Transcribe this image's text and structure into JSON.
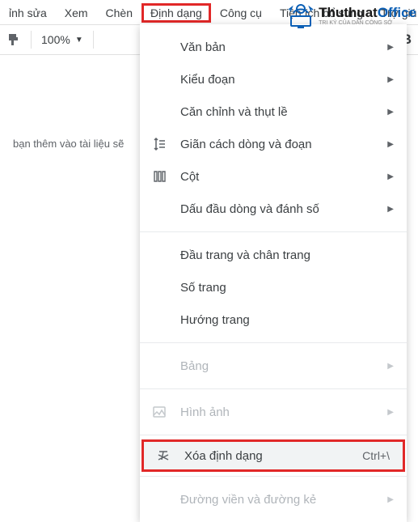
{
  "watermark": {
    "brand_prefix": "Thuthuat",
    "brand_suffix": "Office",
    "tagline": "TRI KỶ CỦA DÂN CÔNG SỞ"
  },
  "menubar": {
    "items": [
      {
        "label": "ỉnh sửa"
      },
      {
        "label": "Xem"
      },
      {
        "label": "Chèn"
      },
      {
        "label": "Định dạng",
        "highlighted": true
      },
      {
        "label": "Công cụ"
      },
      {
        "label": "Tiện ích bổ sung"
      },
      {
        "label": "Trợ giú"
      }
    ]
  },
  "toolbar": {
    "zoom": "100%",
    "plus": "+",
    "bold": "B"
  },
  "document": {
    "body_fragment": "bạn thêm vào tài liệu sẽ"
  },
  "format_menu": {
    "items": [
      {
        "label": "Văn bản",
        "submenu": true
      },
      {
        "label": "Kiểu đoạn",
        "submenu": true
      },
      {
        "label": "Căn chỉnh và thụt lề",
        "submenu": true
      },
      {
        "label": "Giãn cách dòng và đoạn",
        "icon": "line-spacing",
        "submenu": true
      },
      {
        "label": "Cột",
        "icon": "columns",
        "submenu": true
      },
      {
        "label": "Dấu đầu dòng và đánh số",
        "submenu": true
      }
    ],
    "group2": [
      {
        "label": "Đầu trang và chân trang"
      },
      {
        "label": "Số trang"
      },
      {
        "label": "Hướng trang"
      }
    ],
    "group3": [
      {
        "label": "Bảng",
        "disabled": true,
        "submenu": true
      }
    ],
    "group4": [
      {
        "label": "Hình ảnh",
        "icon": "image",
        "disabled": true,
        "submenu": true
      }
    ],
    "group5": [
      {
        "label": "Xóa định dạng",
        "icon": "clear-format",
        "shortcut": "Ctrl+\\",
        "boxed": true
      }
    ],
    "group6": [
      {
        "label": "Đường viền và đường kẻ",
        "disabled": true,
        "submenu": true
      }
    ]
  }
}
